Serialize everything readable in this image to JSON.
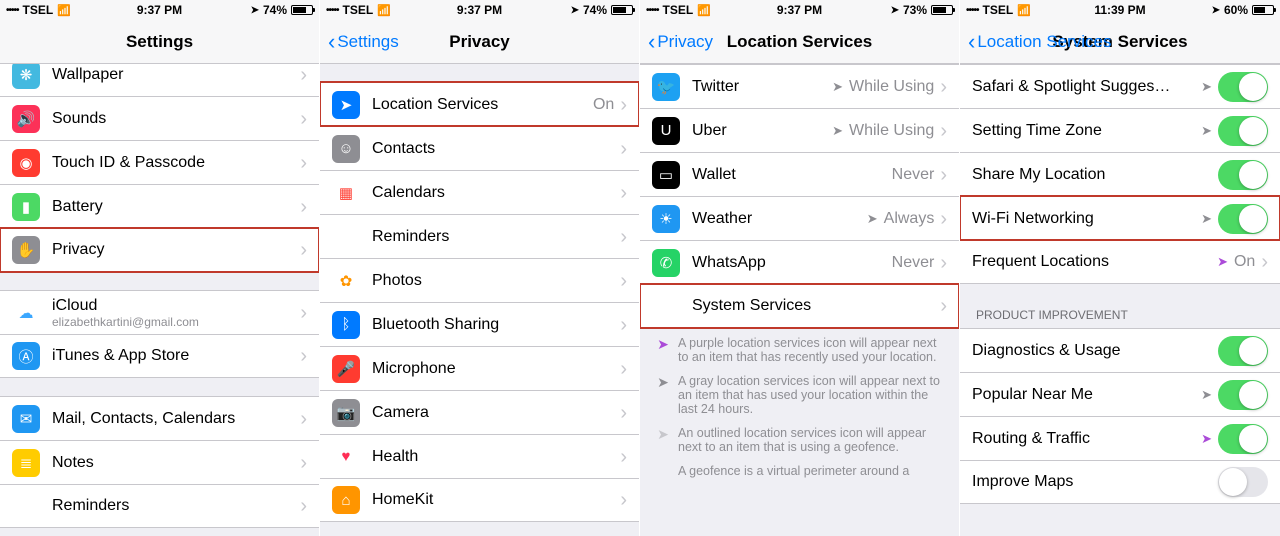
{
  "screens": [
    {
      "status": {
        "carrier": "TSEL",
        "time": "9:37 PM",
        "battery_pct": "74%",
        "battery_fill": 74
      },
      "nav": {
        "back": null,
        "title": "Settings"
      },
      "groups": [
        {
          "rows": [
            {
              "icon": "wallpaper-icon",
              "icon_bg": "#43b9e0",
              "icon_glyph": "❋",
              "label": "Wallpaper"
            },
            {
              "icon": "sounds-icon",
              "icon_bg": "#fc3158",
              "icon_glyph": "🔊",
              "label": "Sounds"
            },
            {
              "icon": "touchid-icon",
              "icon_bg": "#ff3b30",
              "icon_glyph": "◉",
              "label": "Touch ID & Passcode"
            },
            {
              "icon": "battery-icon",
              "icon_bg": "#4cd964",
              "icon_glyph": "▮",
              "label": "Battery"
            },
            {
              "icon": "privacy-icon",
              "icon_bg": "#8e8e93",
              "icon_glyph": "✋",
              "label": "Privacy",
              "highlight": true
            }
          ]
        },
        {
          "rows": [
            {
              "icon": "icloud-icon",
              "icon_bg": "#ffffff",
              "icon_glyph": "☁",
              "icon_color": "#3ba7ff",
              "label": "iCloud",
              "sublabel": "elizabethkartini@gmail.com"
            },
            {
              "icon": "appstore-icon",
              "icon_bg": "#1f97f2",
              "icon_glyph": "Ⓐ",
              "label": "iTunes & App Store"
            }
          ]
        },
        {
          "rows": [
            {
              "icon": "mail-icon",
              "icon_bg": "#1f97f2",
              "icon_glyph": "✉",
              "label": "Mail, Contacts, Calendars"
            },
            {
              "icon": "notes-icon",
              "icon_bg": "#ffcc00",
              "icon_glyph": "≣",
              "label": "Notes"
            },
            {
              "icon": "reminders-icon",
              "icon_bg": "#ffffff",
              "icon_glyph": "•",
              "label": "Reminders"
            }
          ]
        }
      ]
    },
    {
      "status": {
        "carrier": "TSEL",
        "time": "9:37 PM",
        "battery_pct": "74%",
        "battery_fill": 74
      },
      "nav": {
        "back": "Settings",
        "title": "Privacy"
      },
      "groups": [
        {
          "rows": [
            {
              "icon": "location-icon",
              "icon_bg": "#007aff",
              "icon_glyph": "➤",
              "label": "Location Services",
              "value": "On",
              "highlight": true
            },
            {
              "icon": "contacts-icon",
              "icon_bg": "#8e8e93",
              "icon_glyph": "☺",
              "label": "Contacts"
            },
            {
              "icon": "calendars-icon",
              "icon_bg": "#ffffff",
              "icon_glyph": "▦",
              "icon_color": "#ff3b30",
              "label": "Calendars"
            },
            {
              "icon": "reminders-icon",
              "icon_bg": "#ffffff",
              "icon_glyph": "≣",
              "label": "Reminders"
            },
            {
              "icon": "photos-icon",
              "icon_bg": "#ffffff",
              "icon_glyph": "✿",
              "icon_color": "#ff9500",
              "label": "Photos"
            },
            {
              "icon": "bluetooth-icon",
              "icon_bg": "#007aff",
              "icon_glyph": "ᛒ",
              "label": "Bluetooth Sharing"
            },
            {
              "icon": "microphone-icon",
              "icon_bg": "#ff3b30",
              "icon_glyph": "🎤",
              "label": "Microphone"
            },
            {
              "icon": "camera-icon",
              "icon_bg": "#8e8e93",
              "icon_glyph": "📷",
              "label": "Camera"
            },
            {
              "icon": "health-icon",
              "icon_bg": "#ffffff",
              "icon_glyph": "♥",
              "icon_color": "#ff2d55",
              "label": "Health"
            },
            {
              "icon": "homekit-icon",
              "icon_bg": "#ff9500",
              "icon_glyph": "⌂",
              "label": "HomeKit"
            }
          ]
        }
      ]
    },
    {
      "status": {
        "carrier": "TSEL",
        "time": "9:37 PM",
        "battery_pct": "73%",
        "battery_fill": 73
      },
      "nav": {
        "back": "Privacy",
        "title": "Location Services"
      },
      "groups": [
        {
          "tight": true,
          "rows": [
            {
              "icon": "twitter-icon",
              "icon_bg": "#1da1f2",
              "icon_glyph": "🐦",
              "label": "Twitter",
              "value": "While Using",
              "loc": "gray"
            },
            {
              "icon": "uber-icon",
              "icon_bg": "#000000",
              "icon_glyph": "U",
              "label": "Uber",
              "value": "While Using",
              "loc": "gray"
            },
            {
              "icon": "wallet-icon",
              "icon_bg": "#000000",
              "icon_glyph": "▭",
              "label": "Wallet",
              "value": "Never"
            },
            {
              "icon": "weather-icon",
              "icon_bg": "#1f97f2",
              "icon_glyph": "☀",
              "label": "Weather",
              "value": "Always",
              "loc": "gray"
            },
            {
              "icon": "whatsapp-icon",
              "icon_bg": "#25d366",
              "icon_glyph": "✆",
              "label": "WhatsApp",
              "value": "Never"
            },
            {
              "noicon": true,
              "label": "System Services",
              "indent": true,
              "highlight": true
            }
          ]
        }
      ],
      "footnotes": [
        {
          "arrow": "purple",
          "text": "A purple location services icon will appear next to an item that has recently used your location."
        },
        {
          "arrow": "gray",
          "text": "A gray location services icon will appear next to an item that has used your location within the last 24 hours."
        },
        {
          "arrow": "outline",
          "text": "An outlined location services icon will appear next to an item that is using a geofence."
        }
      ],
      "footnote_tail": "A geofence is a virtual perimeter around a"
    },
    {
      "status": {
        "carrier": "TSEL",
        "time": "11:39 PM",
        "battery_pct": "60%",
        "battery_fill": 60
      },
      "nav": {
        "back": "Location Services",
        "title": "System Services"
      },
      "groups": [
        {
          "tight": true,
          "rows": [
            {
              "label": "Safari & Spotlight Sugges…",
              "loc": "gray",
              "toggle": true,
              "toggle_on": true
            },
            {
              "label": "Setting Time Zone",
              "loc": "gray",
              "toggle": true,
              "toggle_on": true
            },
            {
              "label": "Share My Location",
              "toggle": true,
              "toggle_on": true
            },
            {
              "label": "Wi-Fi Networking",
              "loc": "gray",
              "toggle": true,
              "toggle_on": true,
              "highlight": true
            },
            {
              "label": "Frequent Locations",
              "loc": "purple",
              "value": "On",
              "chevron": true
            }
          ]
        },
        {
          "header": "PRODUCT IMPROVEMENT",
          "rows": [
            {
              "label": "Diagnostics & Usage",
              "toggle": true,
              "toggle_on": true
            },
            {
              "label": "Popular Near Me",
              "loc": "gray",
              "toggle": true,
              "toggle_on": true
            },
            {
              "label": "Routing & Traffic",
              "loc": "purple",
              "toggle": true,
              "toggle_on": true
            },
            {
              "label": "Improve Maps",
              "toggle": true,
              "toggle_on": false
            }
          ]
        }
      ]
    }
  ]
}
